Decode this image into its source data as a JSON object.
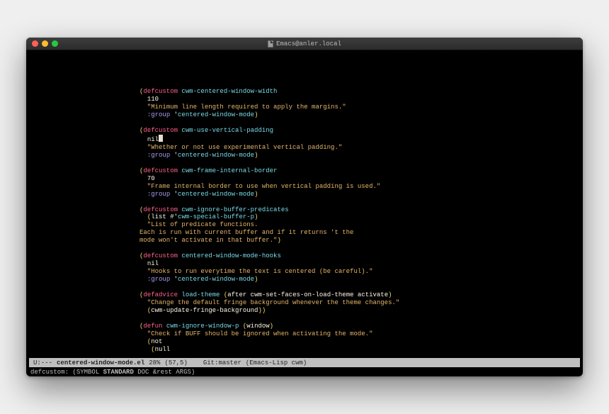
{
  "titlebar": {
    "title": "Emacs@anler.local"
  },
  "code": {
    "b1": {
      "open": "(",
      "defcustom": "defcustom",
      "sp": " ",
      "name": "cwm-centered-window-width",
      "val_indent": "  ",
      "val": "110",
      "doc_indent": "  ",
      "doc": "\"Minimum line length required to apply the margins.\"",
      "grp_indent": "  ",
      "key": ":group",
      "sp2": " ",
      "q": "'",
      "grp": "centered-window-mode",
      "close": ")"
    },
    "b2": {
      "open": "(",
      "defcustom": "defcustom",
      "sp": " ",
      "name": "cwm-use-vertical-padding",
      "val_indent": "  ",
      "val": "nil",
      "doc_indent": "  ",
      "doc": "\"Whether or not use experimental vertical padding.\"",
      "grp_indent": "  ",
      "key": ":group",
      "sp2": " ",
      "q": "'",
      "grp": "centered-window-mode",
      "close": ")"
    },
    "b3": {
      "open": "(",
      "defcustom": "defcustom",
      "sp": " ",
      "name": "cwm-frame-internal-border",
      "val_indent": "  ",
      "val": "70",
      "doc_indent": "  ",
      "doc": "\"Frame internal border to use when vertical padding is used.\"",
      "grp_indent": "  ",
      "key": ":group",
      "sp2": " ",
      "q": "'",
      "grp": "centered-window-mode",
      "close": ")"
    },
    "b4": {
      "open": "(",
      "defcustom": "defcustom",
      "sp": " ",
      "name": "cwm-ignore-buffer-predicates",
      "l2_indent": "  ",
      "l2_open": "(",
      "list": "list",
      "sp2": " ",
      "hash": "#'",
      "pred": "cwm-special-buffer-p",
      "l2_close": ")",
      "doc_indent": "  ",
      "doc1": "\"List of predicate functions.",
      "doc2": "Each is run with current buffer and if it returns 't the",
      "doc3": "mode won't activate in that buffer.\"",
      "close": ")"
    },
    "b5": {
      "open": "(",
      "defcustom": "defcustom",
      "sp": " ",
      "name": "centered-window-mode-hooks",
      "val_indent": "  ",
      "val": "nil",
      "doc_indent": "  ",
      "doc": "\"Hooks to run everytime the text is centered (be careful).\"",
      "grp_indent": "  ",
      "key": ":group",
      "sp2": " ",
      "q": "'",
      "grp": "centered-window-mode",
      "close": ")"
    },
    "b6": {
      "open": "(",
      "defadvice": "defadvice",
      "sp": " ",
      "name": "load-theme",
      "sp2": " ",
      "args_open": "(",
      "a1": "after",
      "asp1": " ",
      "a2": "cwm-set-faces-on-load-theme",
      "asp2": " ",
      "a3": "activate",
      "args_close": ")",
      "doc_indent": "  ",
      "doc": "\"Change the default fringe background whenever the theme changes.\"",
      "body_indent": "  ",
      "body_open": "(",
      "fn": "cwm-update-fringe-background",
      "body_close": "))"
    },
    "b7": {
      "open": "(",
      "defun": "defun",
      "sp": " ",
      "name": "cwm-ignore-window-p",
      "sp2": " ",
      "args_open": "(",
      "arg": "window",
      "args_close": ")",
      "doc_indent": "  ",
      "doc": "\"Check if BUFF should be ignored when activating the mode.\"",
      "not_indent": "  ",
      "not_open": "(",
      "not": "not",
      "null_indent": "   ",
      "null_open": "(",
      "null": "null"
    }
  },
  "modeline": {
    "left": "U:---",
    "buffer": "centered-window-mode.el",
    "pct": "28%",
    "pos": "(57,5)",
    "git": "Git:master",
    "modes": "(Emacs-Lisp cwm)"
  },
  "echo": {
    "fn": "defcustom",
    "colon": ": ",
    "a_open": "(",
    "a1": "SYMBOL ",
    "a2": "STANDARD",
    "a3": " DOC &rest ARGS",
    "a_close": ")"
  }
}
